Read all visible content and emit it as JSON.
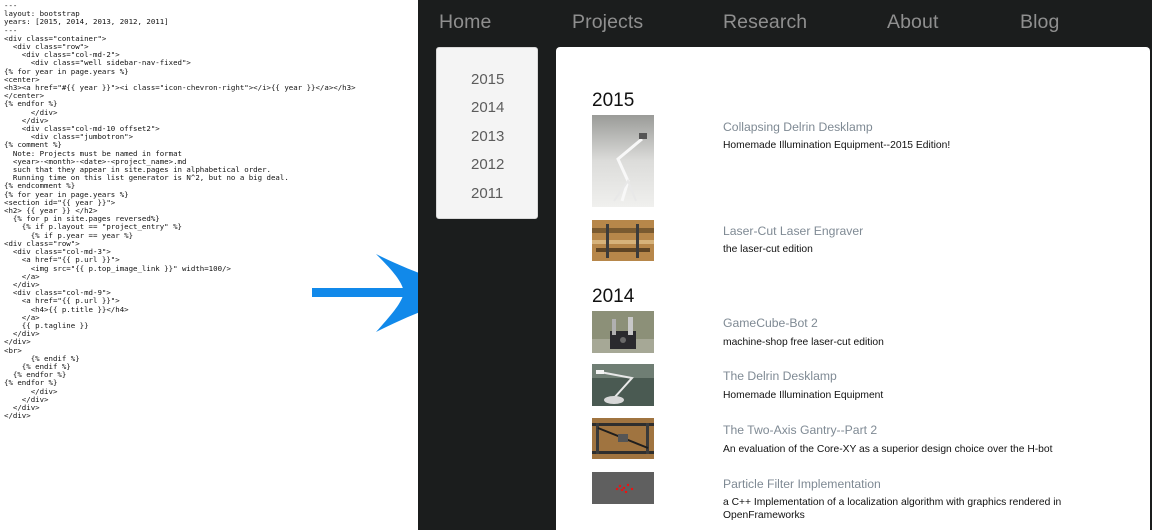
{
  "code": {
    "lines": [
      "---",
      "layout: bootstrap",
      "years: [2015, 2014, 2013, 2012, 2011]",
      "---",
      "<div class=\"container\">",
      "  <div class=\"row\">",
      "    <div class=\"col-md-2\">",
      "      <div class=\"well sidebar-nav-fixed\">",
      "{% for year in page.years %}",
      "<center>",
      "<h3><a href=\"#{{ year }}\"><i class=\"icon-chevron-right\"></i>{{ year }}</a></h3>",
      "</center>",
      "{% endfor %}",
      "      </div>",
      "    </div>",
      "    <div class=\"col-md-10 offset2\">",
      "      <div class=\"jumbotron\">",
      "",
      "{% comment %}",
      "  Note: Projects must be named in format",
      "  <year>-<month>-<date>-<project_name>.md",
      "  such that they appear in site.pages in alphabetical order.",
      "",
      "  Running time on this list generator is N^2, but no a big deal.",
      "{% endcomment %}",
      "",
      "{% for year in page.years %}",
      "<section id=\"{{ year }}\">",
      "<h2> {{ year }} </h2>",
      "  {% for p in site.pages reversed%}",
      "    {% if p.layout == \"project_entry\" %}",
      "      {% if p.year == year %}",
      "<div class=\"row\">",
      "  <div class=\"col-md-3\">",
      "    <a href=\"{{ p.url }}\">",
      "      <img src=\"{{ p.top_image_link }}\" width=100/>",
      "    </a>",
      "  </div>",
      "  <div class=\"col-md-9\">",
      "    <a href=\"{{ p.url }}\">",
      "      <h4>{{ p.title }}</h4>",
      "    </a>",
      "    {{ p.tagline }}",
      "  </div>",
      "</div>",
      "<br>",
      "      {% endif %}",
      "    {% endif %}",
      "  {% endfor %}",
      "{% endfor %}",
      "",
      "      </div>",
      "    </div>",
      "  </div>",
      "</div>"
    ]
  },
  "site": {
    "nav": [
      "Home",
      "Projects",
      "Research",
      "About",
      "Blog"
    ],
    "years": [
      "2015",
      "2014",
      "2013",
      "2012",
      "2011"
    ],
    "sections": [
      {
        "year": "2015",
        "projects": [
          {
            "title": "Collapsing Delrin Desklamp",
            "tagline": "Homemade Illumination Equipment--2015 Edition!"
          },
          {
            "title": "Laser-Cut Laser Engraver",
            "tagline": "the laser-cut edition"
          }
        ]
      },
      {
        "year": "2014",
        "projects": [
          {
            "title": "GameCube-Bot 2",
            "tagline": "machine-shop free laser-cut edition"
          },
          {
            "title": "The Delrin Desklamp",
            "tagline": "Homemade Illumination Equipment"
          },
          {
            "title": "The Two-Axis Gantry--Part 2",
            "tagline": "An evaluation of the Core-XY as a superior design choice over the H-bot"
          },
          {
            "title": "Particle Filter Implementation",
            "tagline": "a C++ Implementation of a localization algorithm with graphics rendered in OpenFrameworks"
          }
        ]
      }
    ]
  },
  "colors": {
    "arrow": "#1189ea",
    "site_background": "#1b1d1d",
    "nav_text": "#8f8f8f",
    "link_title": "#7f8a94"
  }
}
